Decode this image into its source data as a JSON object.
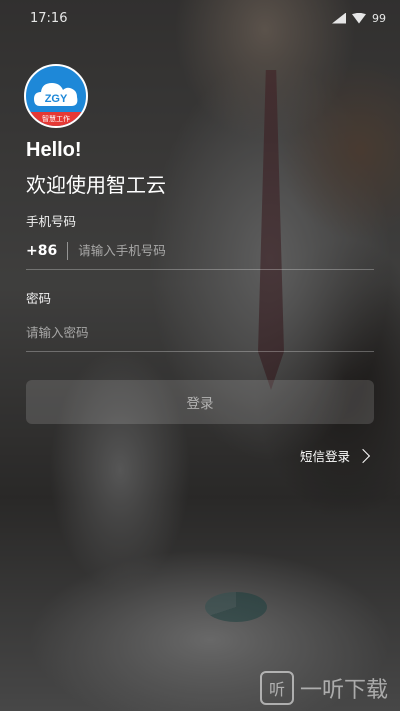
{
  "status_bar": {
    "time": "17:16",
    "battery": "99"
  },
  "logo": {
    "text": "ZGY",
    "ribbon": "智慧工作"
  },
  "greeting": "Hello!",
  "welcome": "欢迎使用智工云",
  "phone": {
    "label": "手机号码",
    "country_code": "+86",
    "placeholder": "请输入手机号码"
  },
  "password": {
    "label": "密码",
    "placeholder": "请输入密码"
  },
  "login_button": "登录",
  "sms_login": "短信登录",
  "watermark": {
    "icon": "听",
    "text": "一听下载"
  }
}
